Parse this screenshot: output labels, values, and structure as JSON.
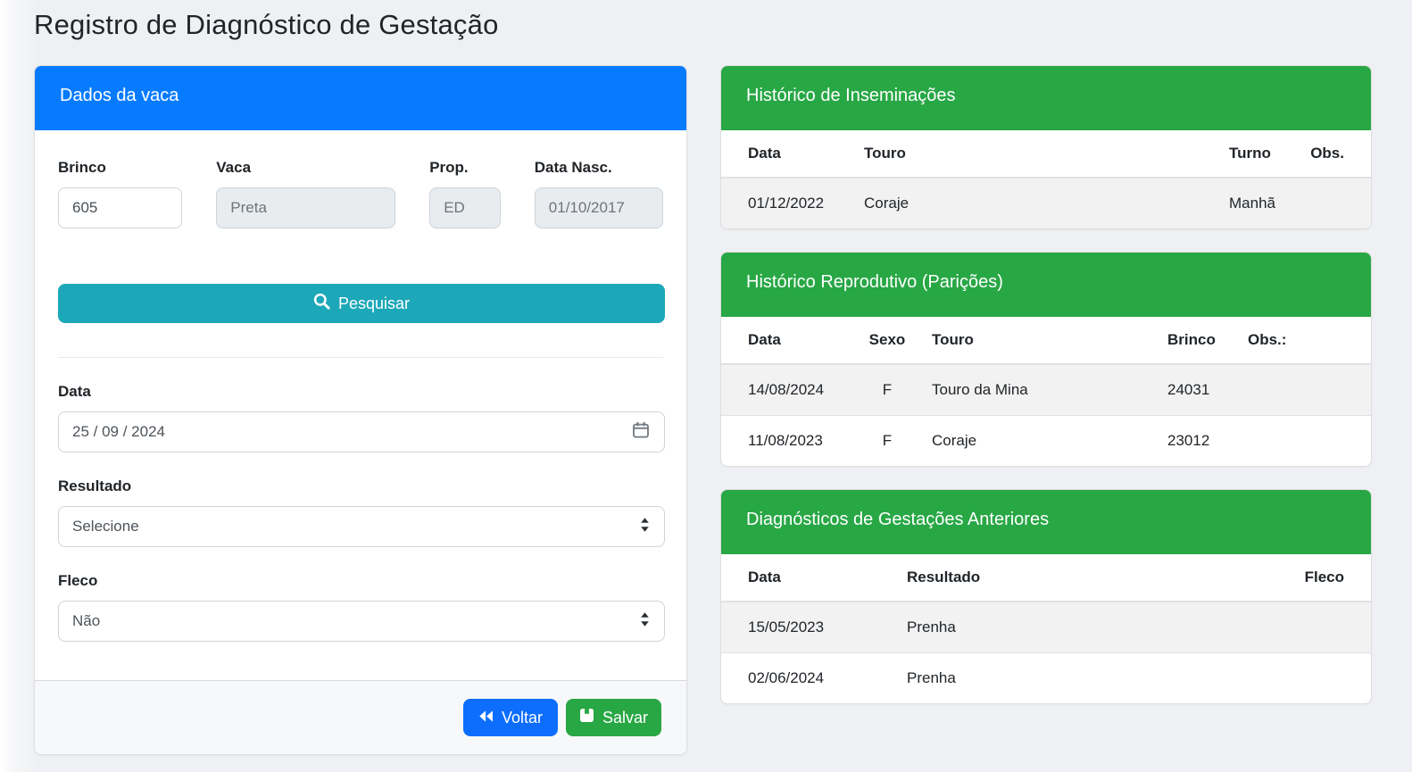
{
  "page": {
    "title": "Registro de Diagnóstico de Gestação"
  },
  "colors": {
    "header_blue": "#077bff",
    "header_green": "#28a745",
    "search_teal": "#1ca8b8",
    "back_button_blue": "#0d6efd",
    "save_button_green": "#28a745",
    "page_background": "#eef0f3",
    "table_stripe": "#f2f2f2",
    "disabled_input_bg": "#e9ecef"
  },
  "icons": {
    "search_icon": "magnifying-glass",
    "calendar_icon": "calendar",
    "select_arrows_icon": "up-down-triangles",
    "back_icon": "double-left-triangles",
    "save_icon": "floppy-disk"
  },
  "cow_form": {
    "header": "Dados da vaca",
    "fields": {
      "brinco": {
        "label": "Brinco",
        "value": "605"
      },
      "vaca": {
        "label": "Vaca",
        "value": "Preta"
      },
      "prop": {
        "label": "Prop.",
        "value": "ED"
      },
      "data_nasc": {
        "label": "Data Nasc.",
        "value": "01/10/2017"
      }
    },
    "search_button_label": "Pesquisar",
    "date_field": {
      "label": "Data",
      "value": "25 / 09 / 2024"
    },
    "resultado_field": {
      "label": "Resultado",
      "value": "Selecione"
    },
    "fleco_field": {
      "label": "Fleco",
      "value": "Não"
    },
    "back_button_label": "Voltar",
    "save_button_label": "Salvar"
  },
  "inseminations": {
    "header": "Histórico de Inseminações",
    "columns": [
      "Data",
      "Touro",
      "Turno",
      "Obs."
    ],
    "rows": [
      [
        "01/12/2022",
        "Coraje",
        "Manhã",
        ""
      ]
    ]
  },
  "partos": {
    "header": "Histórico Reprodutivo (Parições)",
    "columns": [
      "Data",
      "Sexo",
      "Touro",
      "Brinco",
      "Obs.:"
    ],
    "rows": [
      [
        "14/08/2024",
        "F",
        "Touro da Mina",
        "24031",
        ""
      ],
      [
        "11/08/2023",
        "F",
        "Coraje",
        "23012",
        ""
      ]
    ]
  },
  "diagnoses": {
    "header": "Diagnósticos de Gestações Anteriores",
    "columns": [
      "Data",
      "Resultado",
      "Fleco"
    ],
    "rows": [
      [
        "15/05/2023",
        "Prenha",
        ""
      ],
      [
        "02/06/2024",
        "Prenha",
        ""
      ]
    ]
  }
}
